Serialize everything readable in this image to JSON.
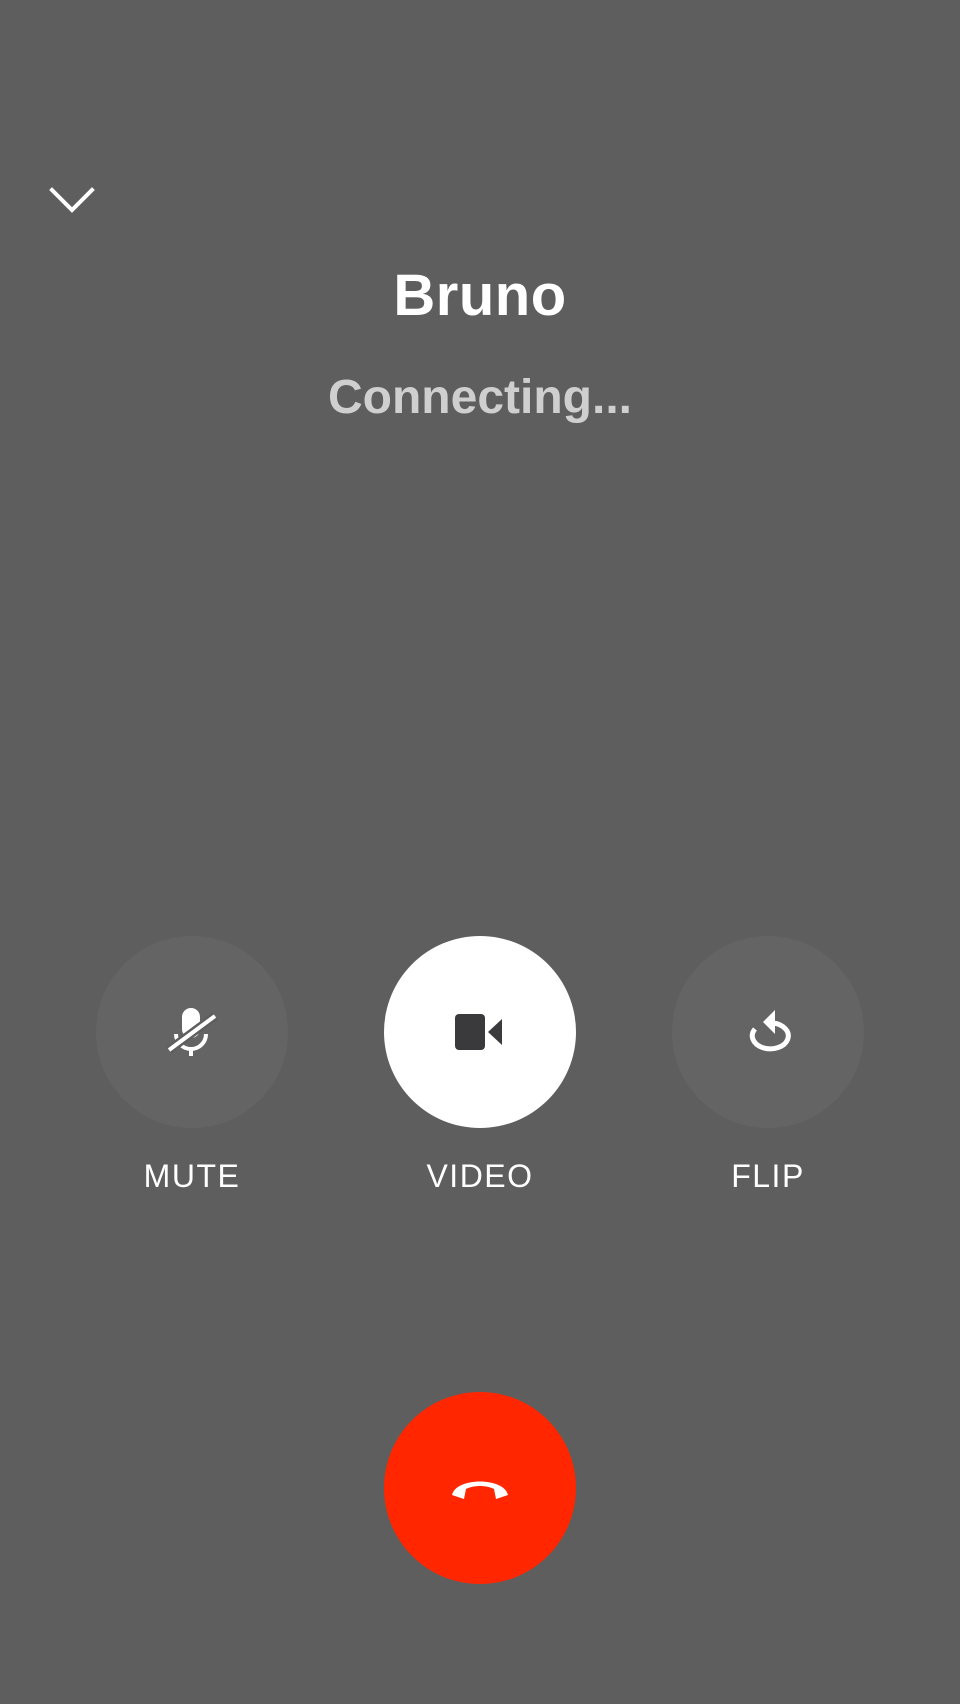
{
  "call": {
    "caller_name": "Bruno",
    "status": "Connecting..."
  },
  "controls": [
    {
      "id": "mute",
      "label": "MUTE",
      "icon": "mic-off-icon",
      "active": false
    },
    {
      "id": "video",
      "label": "VIDEO",
      "icon": "video-camera-icon",
      "active": true
    },
    {
      "id": "flip",
      "label": "FLIP",
      "icon": "flip-camera-icon",
      "active": false
    }
  ],
  "end_call": {
    "icon": "end-call-icon"
  },
  "header": {
    "collapse_icon": "chevron-down-icon"
  },
  "colors": {
    "background": "#5e5e5e",
    "end_call": "#ff2600",
    "active_button": "#ffffff",
    "status_text": "#cfcfcf"
  }
}
